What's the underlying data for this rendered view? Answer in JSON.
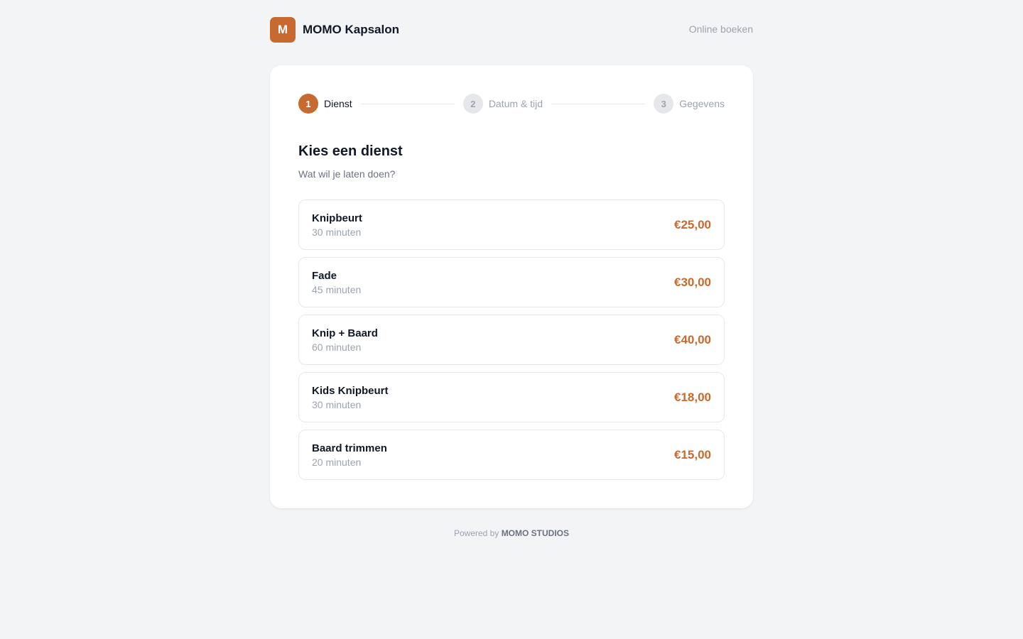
{
  "colors": {
    "accent": "#c8692f"
  },
  "header": {
    "logo_letter": "M",
    "brand_name": "MOMO Kapsalon",
    "online_link": "Online boeken"
  },
  "steps": [
    {
      "number": "1",
      "label": "Dienst",
      "active": true
    },
    {
      "number": "2",
      "label": "Datum & tijd",
      "active": false
    },
    {
      "number": "3",
      "label": "Gegevens",
      "active": false
    }
  ],
  "main": {
    "title": "Kies een dienst",
    "subtitle": "Wat wil je laten doen?"
  },
  "services": [
    {
      "name": "Knipbeurt",
      "duration": "30 minuten",
      "price": "€25,00"
    },
    {
      "name": "Fade",
      "duration": "45 minuten",
      "price": "€30,00"
    },
    {
      "name": "Knip + Baard",
      "duration": "60 minuten",
      "price": "€40,00"
    },
    {
      "name": "Kids Knipbeurt",
      "duration": "30 minuten",
      "price": "€18,00"
    },
    {
      "name": "Baard trimmen",
      "duration": "20 minuten",
      "price": "€15,00"
    }
  ],
  "footer": {
    "powered_by": "Powered by",
    "studio": "MOMO STUDIOS"
  }
}
